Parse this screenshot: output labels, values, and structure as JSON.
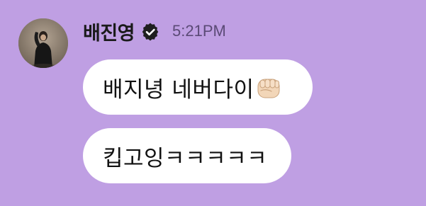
{
  "message": {
    "sender_name": "배진영",
    "timestamp": "5:21PM",
    "verified_icon": "verified-badge-icon",
    "avatar_icon": "profile-photo",
    "bubbles": [
      {
        "text": "배지녕 네버다이",
        "emoji_icon": "oncoming-fist-icon"
      },
      {
        "text": "킵고잉ㅋㅋㅋㅋㅋ"
      }
    ]
  },
  "colors": {
    "background": "#bf9fe3",
    "bubble": "#ffffff",
    "name_text": "#1a1a1a",
    "timestamp_text": "#5b4a76"
  }
}
